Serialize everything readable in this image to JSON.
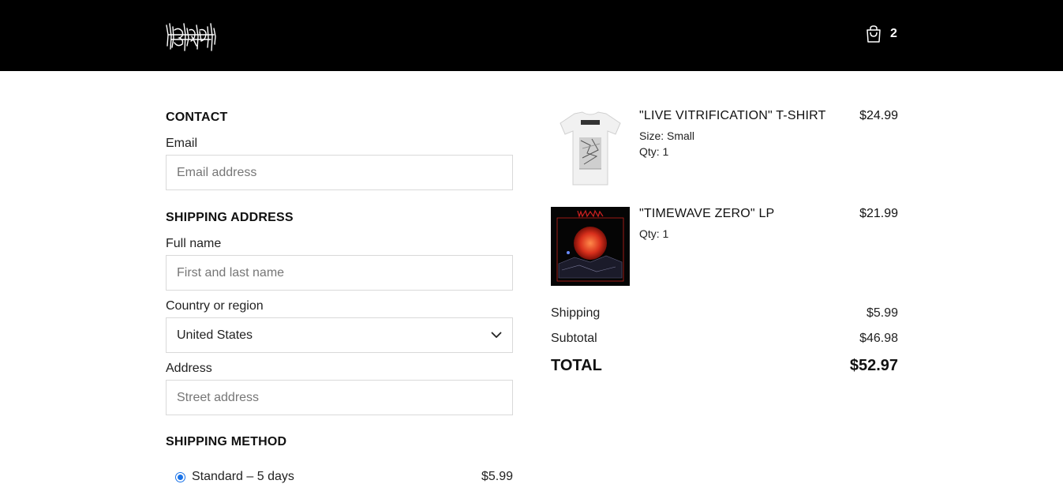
{
  "header": {
    "logo_alt": "Blood Incantation",
    "cart_count": "2"
  },
  "contact": {
    "title": "CONTACT",
    "email_label": "Email",
    "email_placeholder": "Email address",
    "email_value": ""
  },
  "shipping_address": {
    "title": "SHIPPING ADDRESS",
    "name_label": "Full name",
    "name_placeholder": "First and last name",
    "name_value": "",
    "country_label": "Country or region",
    "country_value": "United States",
    "address_label": "Address",
    "address_placeholder": "Street address",
    "address_value": ""
  },
  "shipping_method": {
    "title": "SHIPPING METHOD",
    "option_label": "Standard – 5 days",
    "option_price": "$5.99",
    "selected": true
  },
  "order": {
    "items": [
      {
        "name": "\"LIVE VITRIFICATION\" T-SHIRT",
        "size": "Size: Small",
        "qty": "Qty: 1",
        "price": "$24.99",
        "thumb": "tshirt-image"
      },
      {
        "name": "\"TIMEWAVE ZERO\" LP",
        "qty": "Qty: 1",
        "price": "$21.99",
        "thumb": "album-cover-image"
      }
    ],
    "shipping_label": "Shipping",
    "shipping_value": "$5.99",
    "subtotal_label": "Subtotal",
    "subtotal_value": "$46.98",
    "total_label": "TOTAL",
    "total_value": "$52.97"
  },
  "colors": {
    "header_bg": "#000000",
    "radio_accent": "#1a73e8",
    "album_red": "#d9301c"
  }
}
